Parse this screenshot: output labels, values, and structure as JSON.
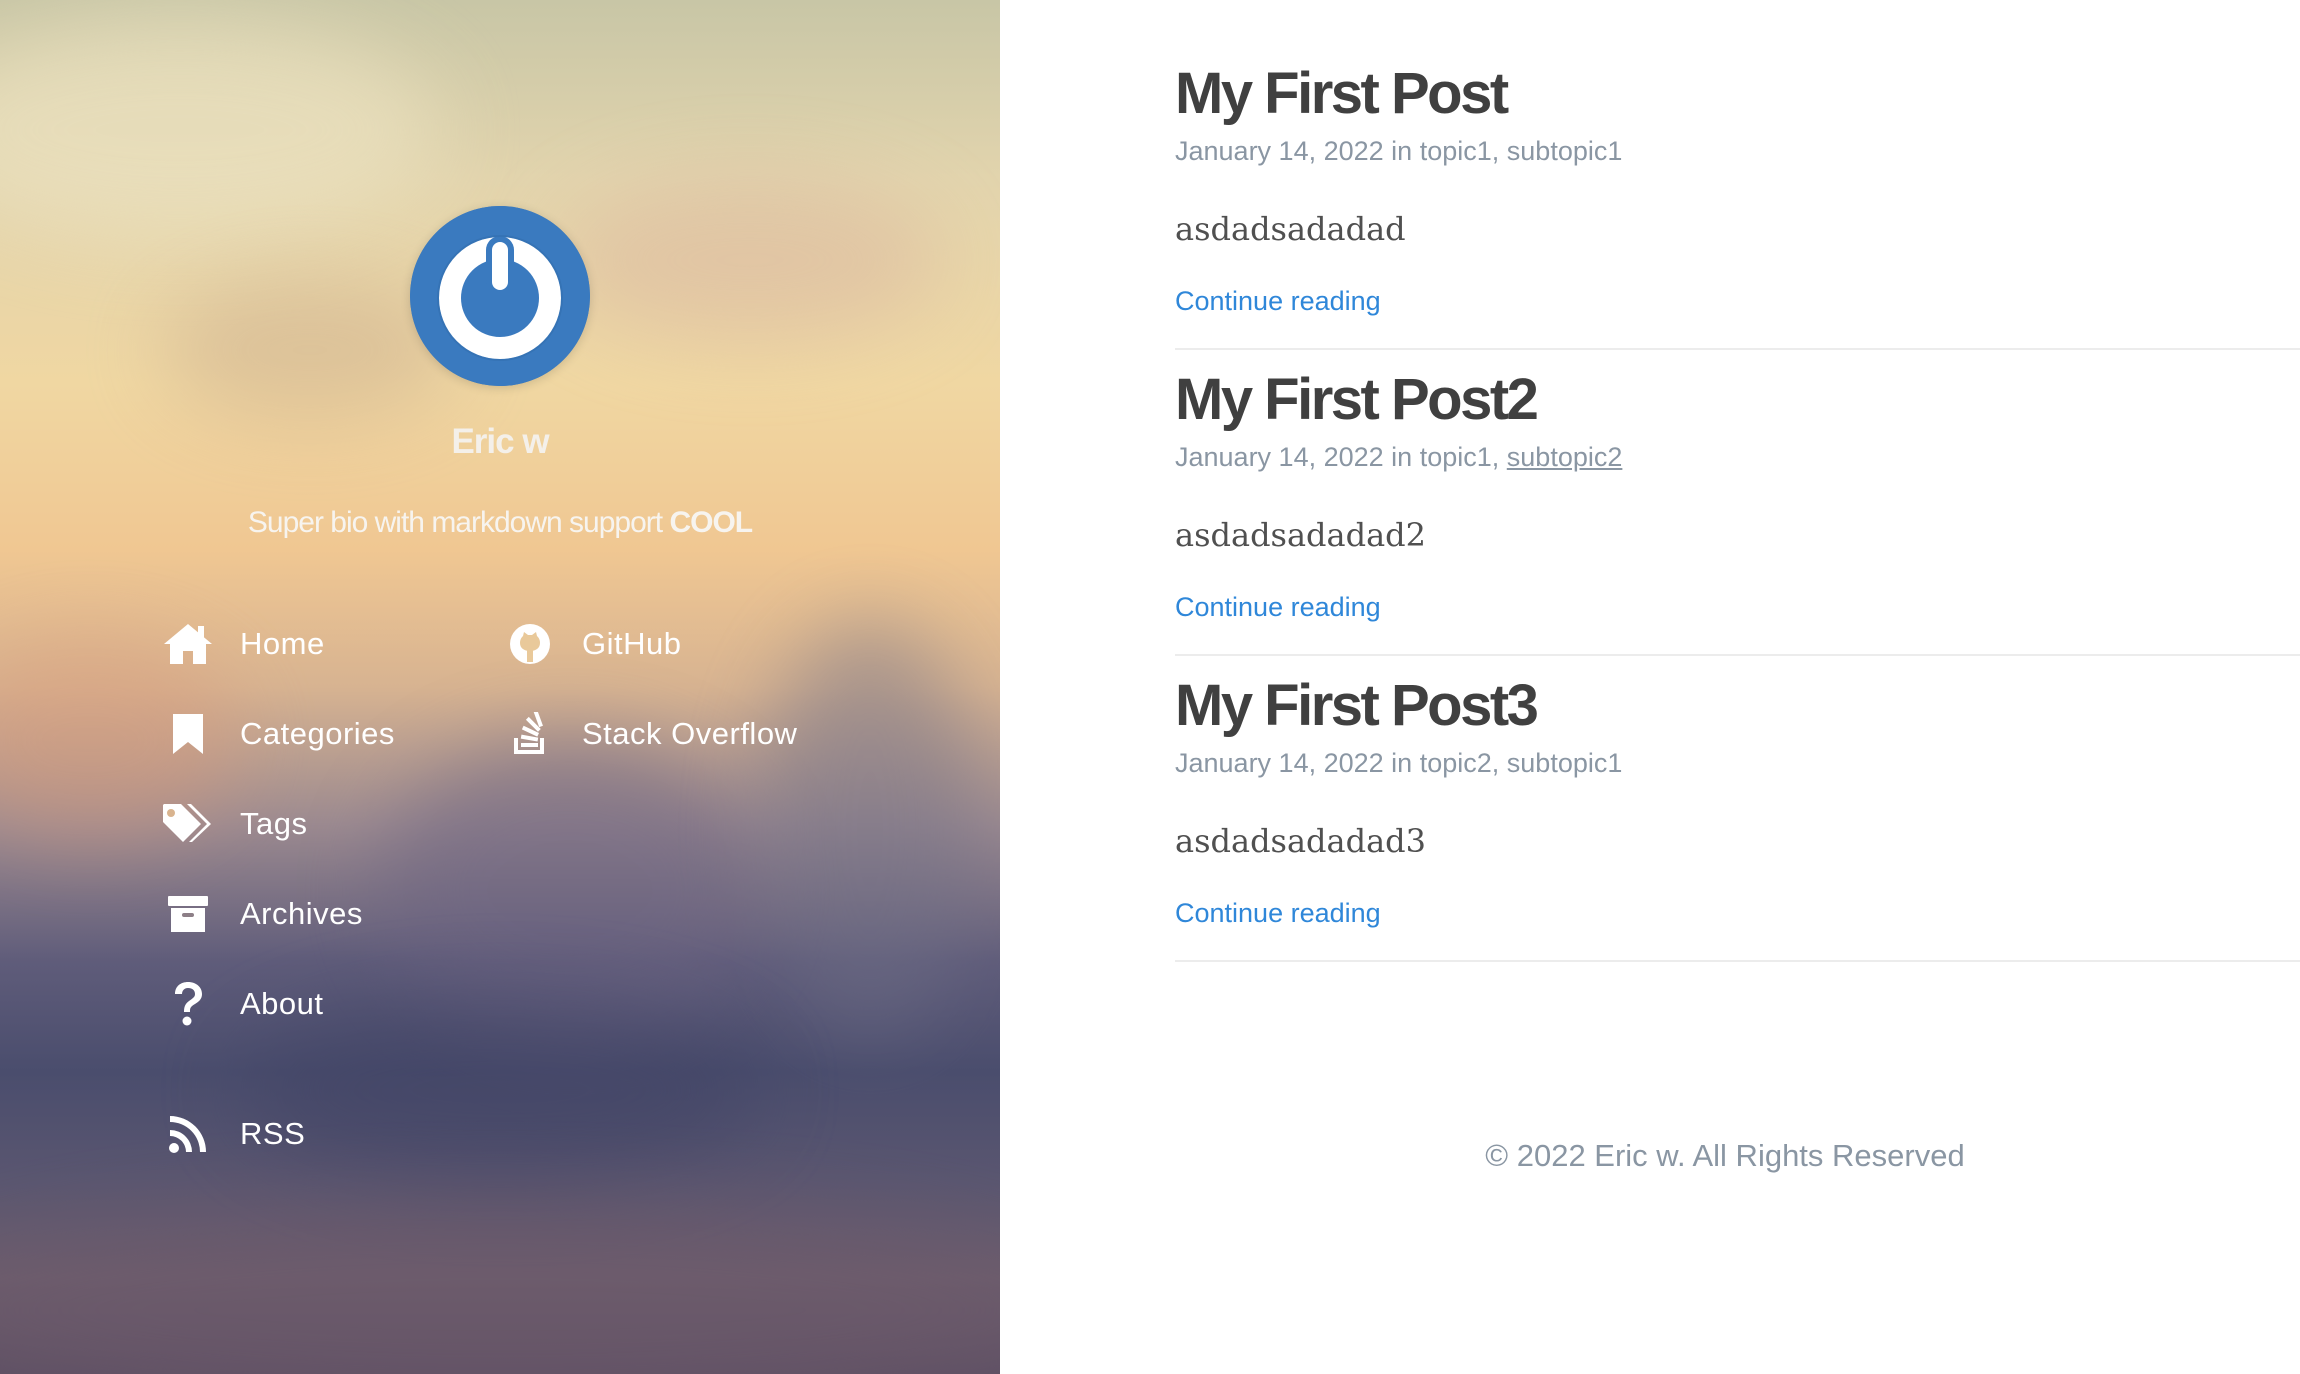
{
  "sidebar": {
    "author_name": "Eric w",
    "bio_prefix": "Super bio with markdown support ",
    "bio_bold": "COOL",
    "nav": [
      {
        "label": "Home",
        "icon": "home-icon"
      },
      {
        "label": "Categories",
        "icon": "bookmark-icon"
      },
      {
        "label": "Tags",
        "icon": "tags-icon"
      },
      {
        "label": "Archives",
        "icon": "archive-icon"
      },
      {
        "label": "About",
        "icon": "question-icon"
      }
    ],
    "social": [
      {
        "label": "GitHub",
        "icon": "github-icon"
      },
      {
        "label": "Stack Overflow",
        "icon": "stack-overflow-icon"
      }
    ],
    "rss": {
      "label": "RSS",
      "icon": "rss-icon"
    }
  },
  "posts": [
    {
      "title": "My First Post",
      "date": "January 14, 2022",
      "in_word": " in ",
      "cat1": "topic1",
      "sep": ", ",
      "cat2": "subtopic1",
      "excerpt": "asdadsadadad",
      "more": "Continue reading"
    },
    {
      "title": "My First Post2",
      "date": "January 14, 2022",
      "in_word": " in ",
      "cat1": "topic1",
      "sep": ", ",
      "cat2": "subtopic2",
      "excerpt": "asdadsadadad2",
      "more": "Continue reading"
    },
    {
      "title": "My First Post3",
      "date": "January 14, 2022",
      "in_word": " in ",
      "cat1": "topic2",
      "sep": ", ",
      "cat2": "subtopic1",
      "excerpt": "asdadsadadad3",
      "more": "Continue reading"
    }
  ],
  "footer": {
    "text": "© 2022 Eric w. All Rights Reserved"
  },
  "colors": {
    "link": "#2f87d9",
    "meta": "#8a96a3",
    "title": "#404040",
    "avatar": "#3a7abf"
  }
}
